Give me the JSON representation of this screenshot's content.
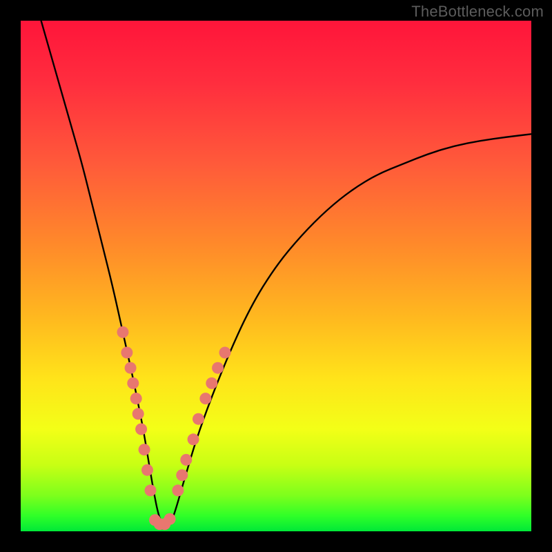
{
  "watermark": "TheBottleneck.com",
  "chart_data": {
    "type": "line",
    "title": "",
    "xlabel": "",
    "ylabel": "",
    "xlim": [
      0,
      100
    ],
    "ylim": [
      0,
      100
    ],
    "annotations": [],
    "series": [
      {
        "name": "bottleneck-curve",
        "x": [
          4,
          6,
          8,
          10,
          12,
          14,
          16,
          18,
          20,
          22,
          23,
          24,
          25,
          26,
          27,
          28,
          29,
          30,
          32,
          35,
          40,
          45,
          50,
          55,
          60,
          65,
          70,
          75,
          80,
          85,
          90,
          95,
          100
        ],
        "y": [
          100,
          93,
          86,
          79,
          72,
          64,
          56,
          48,
          39,
          30,
          25,
          20,
          14,
          8,
          3,
          1,
          1,
          3,
          10,
          20,
          33,
          44,
          52,
          58,
          63,
          67,
          70,
          72,
          74,
          75.5,
          76.5,
          77.2,
          77.8
        ]
      }
    ],
    "markers": [
      {
        "name": "left-cluster",
        "color": "#e8776f",
        "points": [
          {
            "x": 20.0,
            "y": 39
          },
          {
            "x": 20.8,
            "y": 35
          },
          {
            "x": 21.5,
            "y": 32
          },
          {
            "x": 22.0,
            "y": 29
          },
          {
            "x": 22.6,
            "y": 26
          },
          {
            "x": 23.0,
            "y": 23
          },
          {
            "x": 23.6,
            "y": 20
          },
          {
            "x": 24.2,
            "y": 16
          },
          {
            "x": 24.8,
            "y": 12
          },
          {
            "x": 25.4,
            "y": 8
          }
        ]
      },
      {
        "name": "bottom-cluster",
        "color": "#e8776f",
        "points": [
          {
            "x": 26.3,
            "y": 2.2
          },
          {
            "x": 27.2,
            "y": 1.4
          },
          {
            "x": 28.2,
            "y": 1.4
          },
          {
            "x": 29.2,
            "y": 2.4
          }
        ]
      },
      {
        "name": "right-cluster",
        "color": "#e8776f",
        "points": [
          {
            "x": 30.8,
            "y": 8
          },
          {
            "x": 31.6,
            "y": 11
          },
          {
            "x": 32.4,
            "y": 14
          },
          {
            "x": 33.8,
            "y": 18
          },
          {
            "x": 34.8,
            "y": 22
          },
          {
            "x": 36.2,
            "y": 26
          },
          {
            "x": 37.4,
            "y": 29
          },
          {
            "x": 38.6,
            "y": 32
          },
          {
            "x": 40.0,
            "y": 35
          }
        ]
      }
    ]
  }
}
